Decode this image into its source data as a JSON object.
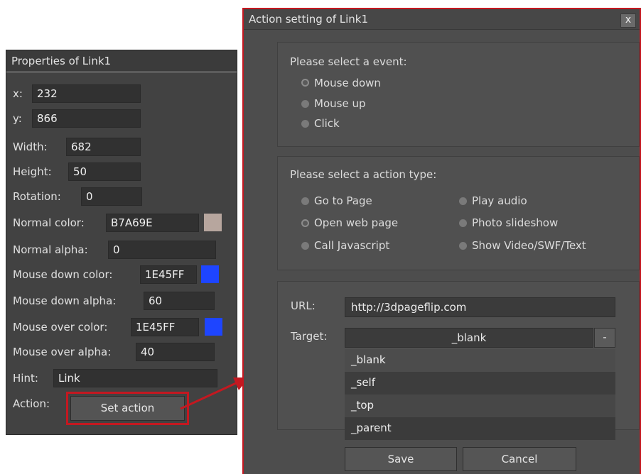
{
  "properties": {
    "title": "Properties of Link1",
    "x_label": "x:",
    "x_value": "232",
    "y_label": "y:",
    "y_value": "866",
    "width_label": "Width:",
    "width_value": "682",
    "height_label": "Height:",
    "height_value": "50",
    "rotation_label": "Rotation:",
    "rotation_value": "0",
    "normal_color_label": "Normal color:",
    "normal_color_value": "B7A69E",
    "normal_color_swatch": "#b7a69e",
    "normal_alpha_label": "Normal alpha:",
    "normal_alpha_value": "0",
    "mouse_down_color_label": "Mouse down color:",
    "mouse_down_color_value": "1E45FF",
    "mouse_down_color_swatch": "#1e45ff",
    "mouse_down_alpha_label": "Mouse down alpha:",
    "mouse_down_alpha_value": "60",
    "mouse_over_color_label": "Mouse over color:",
    "mouse_over_color_value": "1E45FF",
    "mouse_over_color_swatch": "#1e45ff",
    "mouse_over_alpha_label": "Mouse over alpha:",
    "mouse_over_alpha_value": "40",
    "hint_label": "Hint:",
    "hint_value": "Link",
    "action_label": "Action:",
    "set_action_label": "Set action"
  },
  "dialog": {
    "title": "Action setting of Link1",
    "close_label": "x",
    "event_heading": "Please select a event:",
    "events": [
      "Mouse down",
      "Mouse up",
      "Click"
    ],
    "action_heading": "Please select a action type:",
    "actions": [
      "Go to Page",
      "Open web page",
      "Call Javascript",
      "Play audio",
      "Photo slideshow",
      "Show Video/SWF/Text"
    ],
    "url_label": "URL:",
    "url_value": "http://3dpageflip.com",
    "target_label": "Target:",
    "target_value": "_blank",
    "target_button": "-",
    "target_options": [
      "_blank",
      "_self",
      "_top",
      "_parent"
    ],
    "save_label": "Save",
    "cancel_label": "Cancel"
  },
  "colors": {
    "highlight_border": "#c41820",
    "panel_bg": "#424242",
    "dialog_bg": "#4d4d4d"
  }
}
